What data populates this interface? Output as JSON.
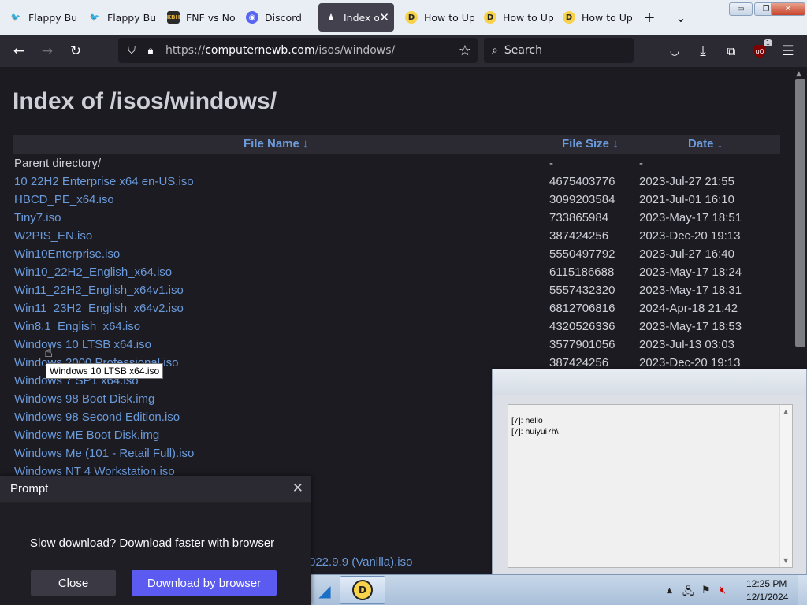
{
  "tabs": [
    {
      "label": "Flappy Bu",
      "icon": "flappy-icon",
      "glyph": "🐦",
      "active": false
    },
    {
      "label": "Flappy Bu",
      "icon": "flappy-icon",
      "glyph": "🐦",
      "active": false
    },
    {
      "label": "FNF vs No",
      "icon": "kbh-icon",
      "glyph": "KBH",
      "active": false
    },
    {
      "label": "Discord",
      "icon": "discord-icon",
      "glyph": "◉",
      "active": false
    },
    {
      "label": "Index of",
      "icon": "index-icon",
      "glyph": "♟",
      "active": true
    },
    {
      "label": "How to Up",
      "icon": "howto-icon",
      "glyph": "D",
      "active": false
    },
    {
      "label": "How to Up",
      "icon": "howto-icon",
      "glyph": "D",
      "active": false
    },
    {
      "label": "How to Up",
      "icon": "howto-icon",
      "glyph": "D",
      "active": false
    }
  ],
  "tabstrip": {
    "new_tab": "+",
    "list_tabs": "⌄",
    "close_tab": "✕"
  },
  "window_controls": {
    "minimize": "▭",
    "restore": "❐",
    "close": "✕"
  },
  "nav": {
    "back": "←",
    "forward": "→",
    "reload": "↻",
    "url_prefix": "https://",
    "url_host": "computernewb.com",
    "url_path": "/isos/windows/",
    "bookmark": "☆",
    "search_placeholder": "Search",
    "search_icon": "⌕",
    "extension_badge": "1",
    "extension_glyph": "uO"
  },
  "page": {
    "title": "Index of /isos/windows/",
    "headers": {
      "name": "File Name  ↓",
      "size": "File Size  ↓",
      "date": "Date  ↓"
    },
    "rows": [
      {
        "name": "Parent directory/",
        "size": "-",
        "date": "-"
      },
      {
        "name": "10 22H2 Enterprise x64 en-US.iso",
        "size": "4675403776",
        "date": "2023-Jul-27 21:55"
      },
      {
        "name": "HBCD_PE_x64.iso",
        "size": "3099203584",
        "date": "2021-Jul-01 16:10"
      },
      {
        "name": "Tiny7.iso",
        "size": "733865984",
        "date": "2023-May-17 18:51"
      },
      {
        "name": "W2PIS_EN.iso",
        "size": "387424256",
        "date": "2023-Dec-20 19:13"
      },
      {
        "name": "Win10Enterprise.iso",
        "size": "5550497792",
        "date": "2023-Jul-27 16:40"
      },
      {
        "name": "Win10_22H2_English_x64.iso",
        "size": "6115186688",
        "date": "2023-May-17 18:24"
      },
      {
        "name": "Win11_22H2_English_x64v1.iso",
        "size": "5557432320",
        "date": "2023-May-17 18:31"
      },
      {
        "name": "Win11_23H2_English_x64v2.iso",
        "size": "6812706816",
        "date": "2024-Apr-18 21:42"
      },
      {
        "name": "Win8.1_English_x64.iso",
        "size": "4320526336",
        "date": "2023-May-17 18:53"
      },
      {
        "name": "Windows 10 LTSB x64.iso",
        "size": "3577901056",
        "date": "2023-Jul-13 03:03"
      },
      {
        "name": "Windows 2000 Professional.iso",
        "size": "387424256",
        "date": "2023-Dec-20 19:13"
      },
      {
        "name": "Windows 7 SP1 x64.iso",
        "size": "",
        "date": ""
      },
      {
        "name": "Windows 98 Boot Disk.img",
        "size": "",
        "date": ""
      },
      {
        "name": "Windows 98 Second Edition.iso",
        "size": "",
        "date": ""
      },
      {
        "name": "Windows ME Boot Disk.img",
        "size": "",
        "date": ""
      },
      {
        "name": "Windows Me (101 - Retail Full).iso",
        "size": "",
        "date": ""
      },
      {
        "name": "Windows NT 4 Workstation.iso",
        "size": "",
        "date": ""
      }
    ],
    "partial_link": "022.9.9 (Vanilla).iso"
  },
  "tooltip": "Windows 10 LTSB x64.iso",
  "prompt": {
    "title": "Prompt",
    "close_x": "✕",
    "message": "Slow download? Download faster with browser",
    "close_button": "Close",
    "download_button": "Download by browser"
  },
  "console": {
    "lines": [
      "[7]: hello",
      "[7]: huiyui7h\\"
    ]
  },
  "taskbar": {
    "time": "12:25 PM",
    "date": "12/1/2024",
    "tray_arrow": "▲",
    "app2_glyph": "D"
  },
  "colors": {
    "link": "#6b9bdb",
    "accent_button": "#5b5bf2",
    "page_bg": "#1c1b22"
  }
}
